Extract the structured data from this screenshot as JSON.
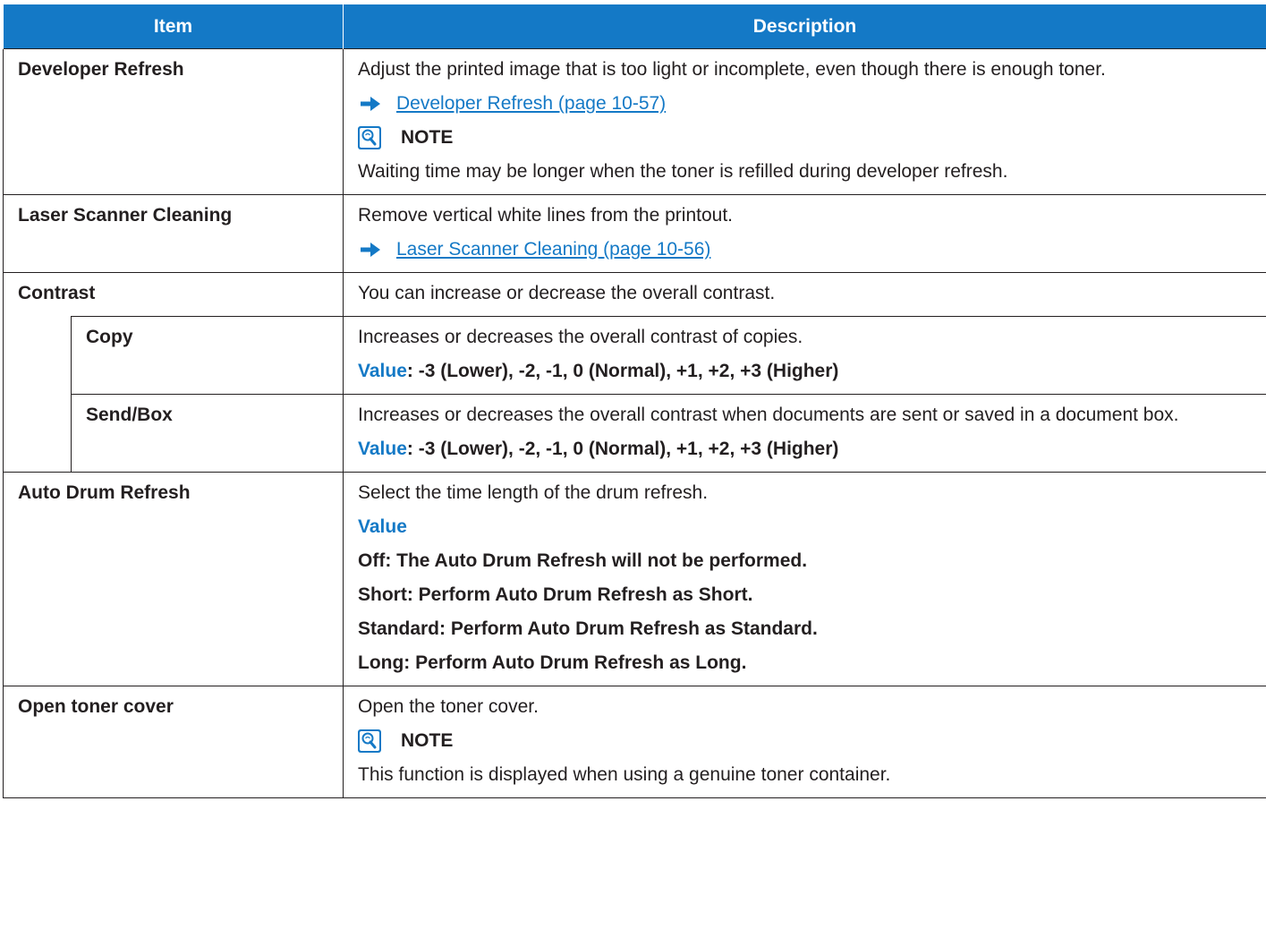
{
  "header": {
    "item": "Item",
    "description": "Description"
  },
  "rows": {
    "developer_refresh": {
      "item": "Developer Refresh",
      "desc": "Adjust the printed image that is too light or incomplete, even though there is enough toner.",
      "link": "Developer Refresh (page 10-57)",
      "note_label": "NOTE",
      "note_text": "Waiting time may be longer when the toner is refilled during developer refresh."
    },
    "laser_scanner": {
      "item": "Laser Scanner Cleaning",
      "desc": "Remove vertical white lines from the printout.",
      "link": "Laser Scanner Cleaning (page 10-56)"
    },
    "contrast": {
      "item": "Contrast",
      "desc": "You can increase or decrease the overall contrast."
    },
    "copy": {
      "item": "Copy",
      "desc": "Increases or decreases the overall contrast of copies.",
      "value_label": "Value",
      "value_text": ": -3 (Lower), -2, -1, 0 (Normal), +1, +2, +3 (Higher)"
    },
    "send_box": {
      "item": "Send/Box",
      "desc": "Increases or decreases the overall contrast when documents are sent or saved in a document box.",
      "value_label": "Value",
      "value_text": ": -3 (Lower), -2, -1, 0 (Normal), +1, +2, +3 (Higher)"
    },
    "auto_drum": {
      "item": "Auto Drum Refresh",
      "desc": "Select the time length of the drum refresh.",
      "value_label": "Value",
      "options": [
        "Off: The Auto Drum Refresh will not be performed.",
        "Short: Perform Auto Drum Refresh as Short.",
        "Standard: Perform Auto Drum Refresh as Standard.",
        "Long: Perform Auto Drum Refresh as Long."
      ]
    },
    "open_toner": {
      "item": "Open toner cover",
      "desc": "Open the toner cover.",
      "note_label": "NOTE",
      "note_text": "This function is displayed when using a genuine toner container."
    }
  },
  "colors": {
    "accent": "#1479c6",
    "text": "#231f20"
  },
  "icons": {
    "link_arrow": "arrow-right-icon",
    "note": "note-lightbulb-icon"
  }
}
